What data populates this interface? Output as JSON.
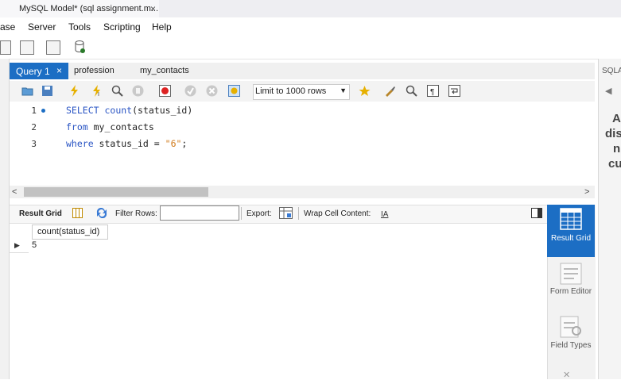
{
  "window": {
    "doc_tab_title": "MySQL Model* (sql assignment.m...",
    "close_glyph": "×"
  },
  "menu": [
    "ase",
    "Server",
    "Tools",
    "Scripting",
    "Help"
  ],
  "editor_tabs": {
    "active": "Query 1",
    "others": [
      "profession",
      "my_contacts"
    ],
    "close_glyph": "×"
  },
  "editor_toolbar": {
    "limit_select": "Limit to 1000 rows"
  },
  "editor": {
    "line_numbers": [
      "1",
      "2",
      "3"
    ],
    "lines": [
      {
        "kw1": "SELECT",
        "kw2": "count",
        "rest": "(status_id)"
      },
      {
        "kw1": "from",
        "rest": " my_contacts"
      },
      {
        "kw1": "where",
        "rest": " status_id = ",
        "str": "\"6\"",
        "end": ";"
      }
    ]
  },
  "result_toolbar": {
    "result_grid": "Result Grid",
    "filter_rows": "Filter Rows:",
    "filter_value": "",
    "export": "Export:",
    "wrap": "Wrap Cell Content:"
  },
  "result_grid": {
    "columns": [
      "count(status_id)"
    ],
    "rows": [
      [
        "5"
      ]
    ]
  },
  "side_panel": {
    "result_grid_label": "Result Grid",
    "form_editor_label": "Form Editor",
    "field_types_label": "Field Types"
  },
  "sql_additions": {
    "tab_label": "SQLA",
    "text_lines": [
      "A",
      "dis",
      "n",
      "cu"
    ]
  },
  "colors": {
    "accent": "#1c6ec4",
    "keyword": "#2a55c4",
    "string": "#d07a1a"
  }
}
